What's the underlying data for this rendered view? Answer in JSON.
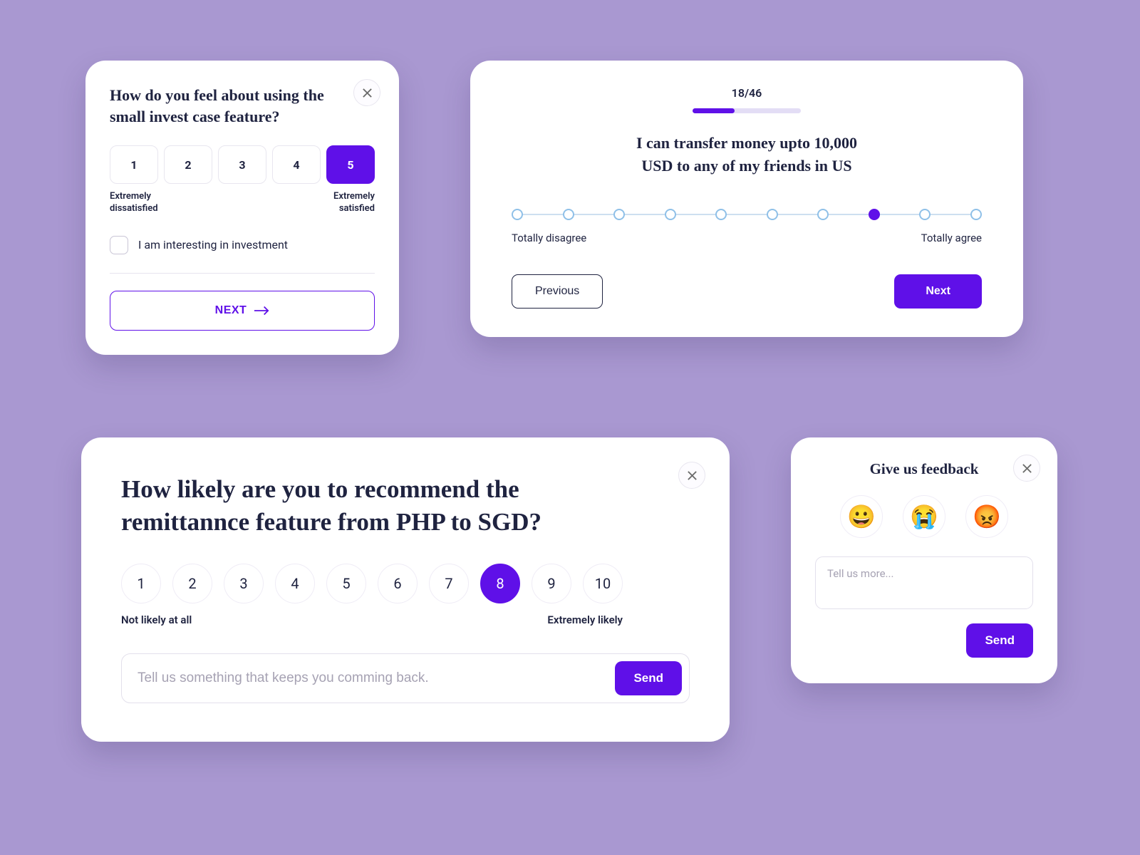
{
  "colors": {
    "accent": "#5f10e8",
    "bg": "#a998d1"
  },
  "cardA": {
    "question": "How do you feel about using the small invest case feature?",
    "scale": [
      "1",
      "2",
      "3",
      "4",
      "5"
    ],
    "selected": "5",
    "low_label": "Extremely dissatisfied",
    "high_label": "Extremely satisfied",
    "checkbox_label": "I am interesting in investment",
    "next_label": "NEXT"
  },
  "cardB": {
    "counter": "18/46",
    "progress_pct": 39,
    "question_line1": "I can transfer money upto 10,000",
    "question_line2": "USD to any of my friends in US",
    "dots": 10,
    "selected_index": 7,
    "low_label": "Totally disagree",
    "high_label": "Totally agree",
    "prev_label": "Previous",
    "next_label": "Next"
  },
  "cardC": {
    "question": "How likely are you to recommend the remittannce feature from PHP to SGD?",
    "scale": [
      "1",
      "2",
      "3",
      "4",
      "5",
      "6",
      "7",
      "8",
      "9",
      "10"
    ],
    "selected": "8",
    "low_label": "Not likely at all",
    "high_label": "Extremely likely",
    "placeholder": "Tell us something that keeps you comming back.",
    "send_label": "Send"
  },
  "cardD": {
    "title": "Give us feedback",
    "emojis": [
      "😀",
      "😭",
      "😡"
    ],
    "placeholder": "Tell us more...",
    "send_label": "Send"
  }
}
